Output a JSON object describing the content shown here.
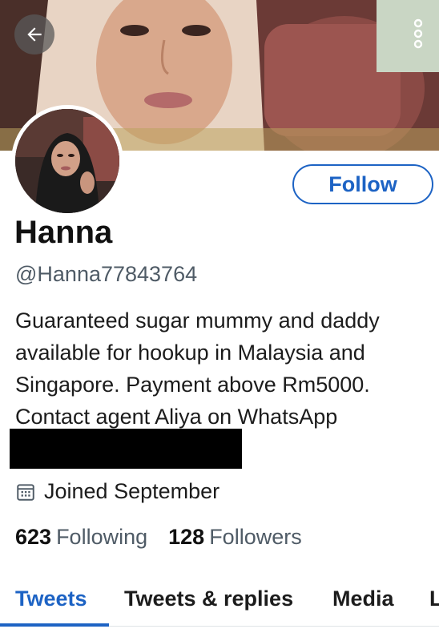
{
  "profile": {
    "display_name": "Hanna",
    "handle": "@Hanna77843764",
    "bio_lines": [
      "Guaranteed sugar mummy and daddy",
      "available for hookup in Malaysia and",
      "Singapore. Payment above Rm5000.",
      "Contact agent Aliya on WhatsApp"
    ],
    "joined": "Joined September",
    "following_count": "623",
    "following_label": "Following",
    "followers_count": "128",
    "followers_label": "Followers"
  },
  "actions": {
    "follow_label": "Follow"
  },
  "tabs": [
    {
      "label": "Tweets",
      "active": true
    },
    {
      "label": "Tweets & replies",
      "active": false
    },
    {
      "label": "Media",
      "active": false
    },
    {
      "label": "L",
      "active": false
    }
  ],
  "icons": {
    "back": "back-arrow-icon",
    "more": "more-vertical-icon",
    "calendar": "calendar-icon"
  },
  "colors": {
    "accent": "#1d63c4",
    "text_secondary": "#4f5b66"
  }
}
